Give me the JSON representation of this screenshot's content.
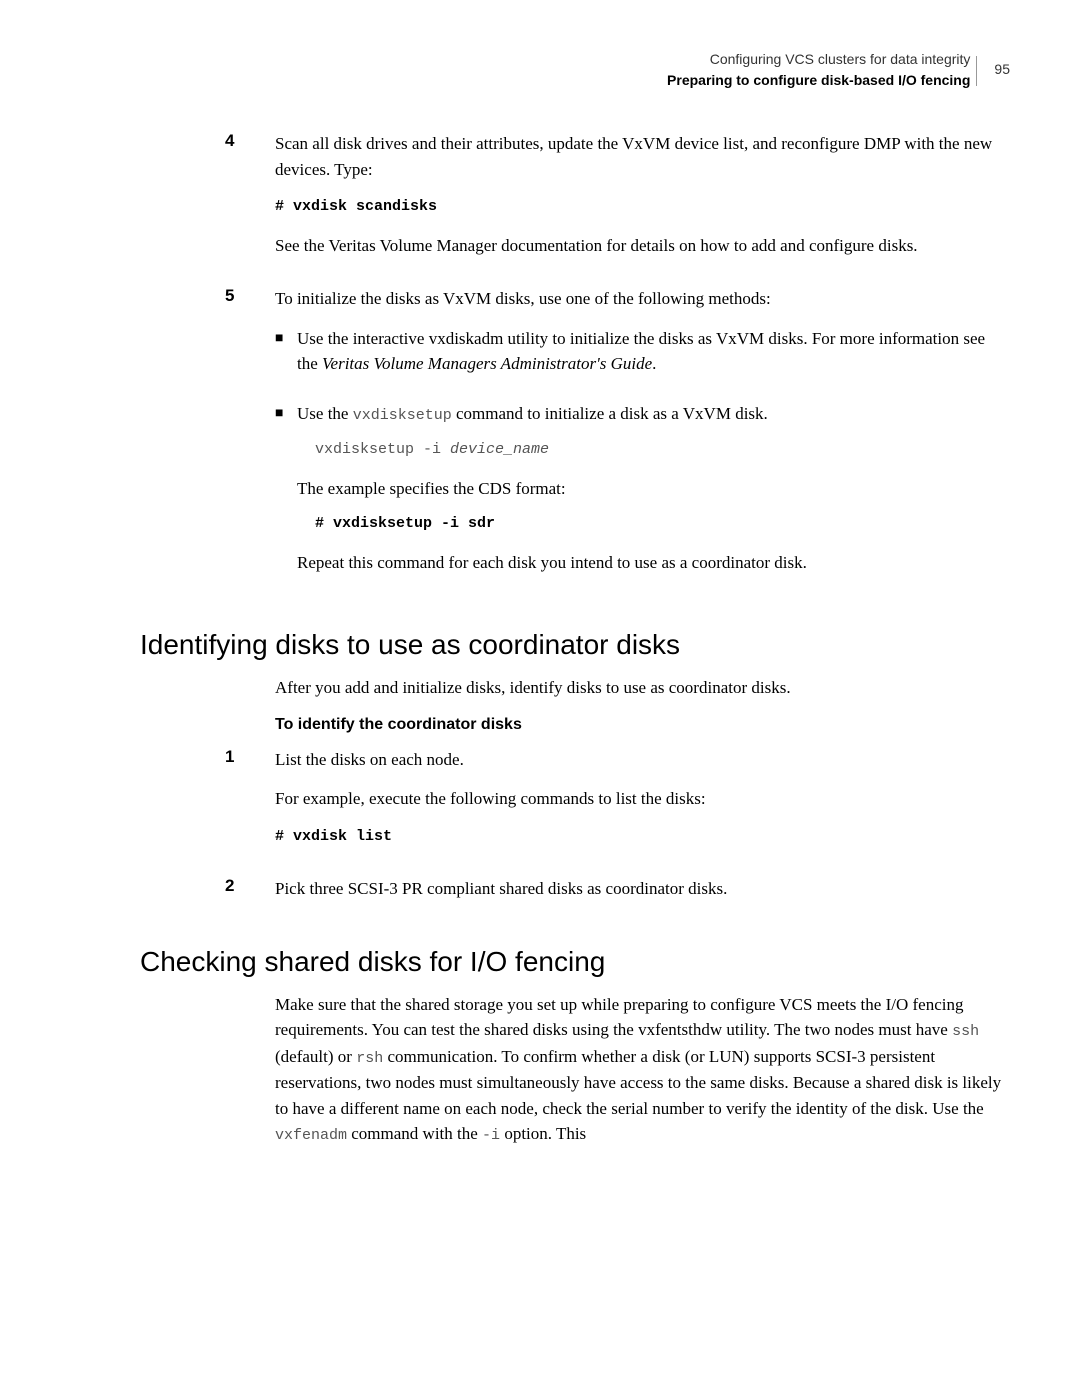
{
  "header": {
    "line1": "Configuring VCS clusters for data integrity",
    "line2": "Preparing to configure disk-based I/O fencing",
    "page": "95"
  },
  "step4": {
    "num": "4",
    "p1": "Scan all disk drives and their attributes, update the VxVM device list, and reconfigure DMP with the new devices. Type:",
    "code": "# vxdisk scandisks",
    "p2": "See the Veritas Volume Manager documentation for details on how to add and configure disks."
  },
  "step5": {
    "num": "5",
    "p1": "To initialize the disks as VxVM disks, use one of the following methods:",
    "bullet1a": "Use the interactive vxdiskadm utility to initialize the disks as VxVM disks. For more information see the ",
    "bullet1b": "Veritas Volume Managers Administrator's Guide",
    "bullet1c": ".",
    "bullet2a": "Use the ",
    "bullet2b": "vxdisksetup",
    "bullet2c": " command to initialize a disk as a VxVM disk.",
    "code2a": "vxdisksetup -i ",
    "code2b": "device_name",
    "p2": "The example specifies the CDS format:",
    "code3": "# vxdisksetup -i sdr",
    "p3": "Repeat this command for each disk you intend to use as a coordinator disk."
  },
  "sec1": {
    "title": "Identifying disks to use as coordinator disks",
    "p1": "After you add and initialize disks, identify disks to use as coordinator disks.",
    "sub": "To identify the coordinator disks",
    "s1num": "1",
    "s1p1": "List the disks on each node.",
    "s1p2": "For example, execute the following commands to list the disks:",
    "s1code": "# vxdisk list",
    "s2num": "2",
    "s2p1": "Pick three SCSI-3 PR compliant shared disks as coordinator disks."
  },
  "sec2": {
    "title": "Checking shared disks for I/O fencing",
    "p1a": "Make sure that the shared storage you set up while preparing to configure VCS meets the I/O fencing requirements. You can test the shared disks using the vxfentsthdw utility. The two nodes must have ",
    "p1b": "ssh",
    "p1c": " (default) or ",
    "p1d": "rsh",
    "p1e": " communication. To confirm whether a disk (or LUN) supports SCSI-3 persistent reservations, two nodes must simultaneously have access to the same disks. Because a shared disk is likely to have a different name on each node, check the serial number to verify the identity of the disk. Use the ",
    "p1f": "vxfenadm",
    "p1g": " command with the ",
    "p1h": "-i",
    "p1i": " option. This"
  }
}
